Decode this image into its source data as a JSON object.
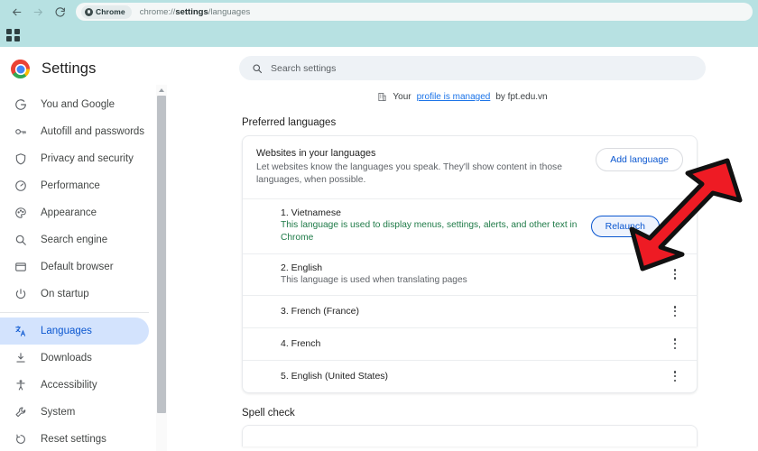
{
  "browser": {
    "back_icon": "back-arrow-icon",
    "forward_icon": "forward-arrow-icon",
    "reload_icon": "reload-icon",
    "tab_label": "Chrome",
    "url_prefix": "chrome://",
    "url_bold": "settings",
    "url_suffix": "/languages",
    "bookmark_grid_icon": "apps-grid-icon",
    "header_color": "#b7e1e2"
  },
  "sidebar": {
    "title": "Settings",
    "logo_icon": "chrome-logo-icon",
    "items": [
      {
        "label": "You and Google",
        "icon": "google-g-icon",
        "active": false
      },
      {
        "label": "Autofill and passwords",
        "icon": "key-icon",
        "active": false
      },
      {
        "label": "Privacy and security",
        "icon": "shield-icon",
        "active": false
      },
      {
        "label": "Performance",
        "icon": "speedometer-icon",
        "active": false
      },
      {
        "label": "Appearance",
        "icon": "palette-icon",
        "active": false
      },
      {
        "label": "Search engine",
        "icon": "search-icon",
        "active": false
      },
      {
        "label": "Default browser",
        "icon": "browser-window-icon",
        "active": false
      },
      {
        "label": "On startup",
        "icon": "power-icon",
        "active": false
      },
      {
        "label": "Languages",
        "icon": "translate-icon",
        "active": true
      },
      {
        "label": "Downloads",
        "icon": "download-icon",
        "active": false
      },
      {
        "label": "Accessibility",
        "icon": "accessibility-icon",
        "active": false
      },
      {
        "label": "System",
        "icon": "wrench-icon",
        "active": false
      },
      {
        "label": "Reset settings",
        "icon": "reset-icon",
        "active": false
      }
    ],
    "active_color": "#0b57d0",
    "active_bg": "#d3e3fd"
  },
  "search": {
    "placeholder": "Search settings",
    "icon": "search-icon"
  },
  "managed_notice": {
    "icon": "building-icon",
    "prefix": "Your",
    "link": "profile is managed",
    "suffix": "by fpt.edu.vn"
  },
  "preferred_languages": {
    "section_title": "Preferred languages",
    "card": {
      "title": "Websites in your languages",
      "subtitle": "Let websites know the languages you speak. They'll show content in those languages, when possible.",
      "add_button": "Add language"
    },
    "languages": [
      {
        "name": "1. Vietnamese",
        "desc": "This language is used to display menus, settings, alerts, and other text in Chrome",
        "desc_green": true,
        "relaunch": "Relaunch",
        "menu_icon": "kebab-menu-icon"
      },
      {
        "name": "2. English",
        "desc": "This language is used when translating pages",
        "desc_green": false,
        "relaunch": "",
        "menu_icon": "kebab-menu-icon"
      },
      {
        "name": "3. French (France)",
        "desc": "",
        "desc_green": false,
        "relaunch": "",
        "menu_icon": "kebab-menu-icon"
      },
      {
        "name": "4. French",
        "desc": "",
        "desc_green": false,
        "relaunch": "",
        "menu_icon": "kebab-menu-icon"
      },
      {
        "name": "5. English (United States)",
        "desc": "",
        "desc_green": false,
        "relaunch": "",
        "menu_icon": "kebab-menu-icon"
      }
    ]
  },
  "spell_check": {
    "section_title": "Spell check"
  },
  "annotation": {
    "arrow_icon": "red-arrow-annotation",
    "color": "#ee1b24",
    "direction": "down-left"
  }
}
